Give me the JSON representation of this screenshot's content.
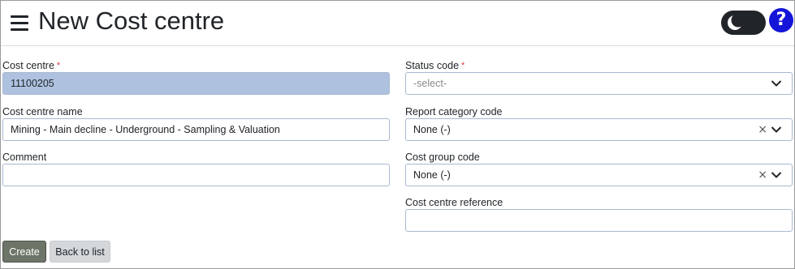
{
  "header": {
    "title": "New Cost centre",
    "menu_icon": "hamburger-menu-icon",
    "theme_icon": "moon-icon",
    "help_glyph": "?"
  },
  "form": {
    "cost_centre": {
      "label": "Cost centre",
      "value": "11100205",
      "required_mark": "*"
    },
    "cost_centre_name": {
      "label": "Cost centre name",
      "value": "Mining - Main decline - Underground - Sampling & Valuation"
    },
    "comment": {
      "label": "Comment",
      "value": ""
    },
    "status_code": {
      "label": "Status code",
      "required_mark": "*",
      "placeholder": "-select-"
    },
    "report_category_code": {
      "label": "Report category code",
      "value": "None (-)"
    },
    "cost_group_code": {
      "label": "Cost group code",
      "value": "None (-)"
    },
    "cost_centre_reference": {
      "label": "Cost centre reference",
      "value": ""
    },
    "clear_glyph": "×"
  },
  "buttons": {
    "create": "Create",
    "back": "Back to list"
  },
  "colors": {
    "accent_help": "#1515d9",
    "required": "#dc3545",
    "highlight_field": "#aec2e0",
    "create_button": "#6c7567"
  }
}
